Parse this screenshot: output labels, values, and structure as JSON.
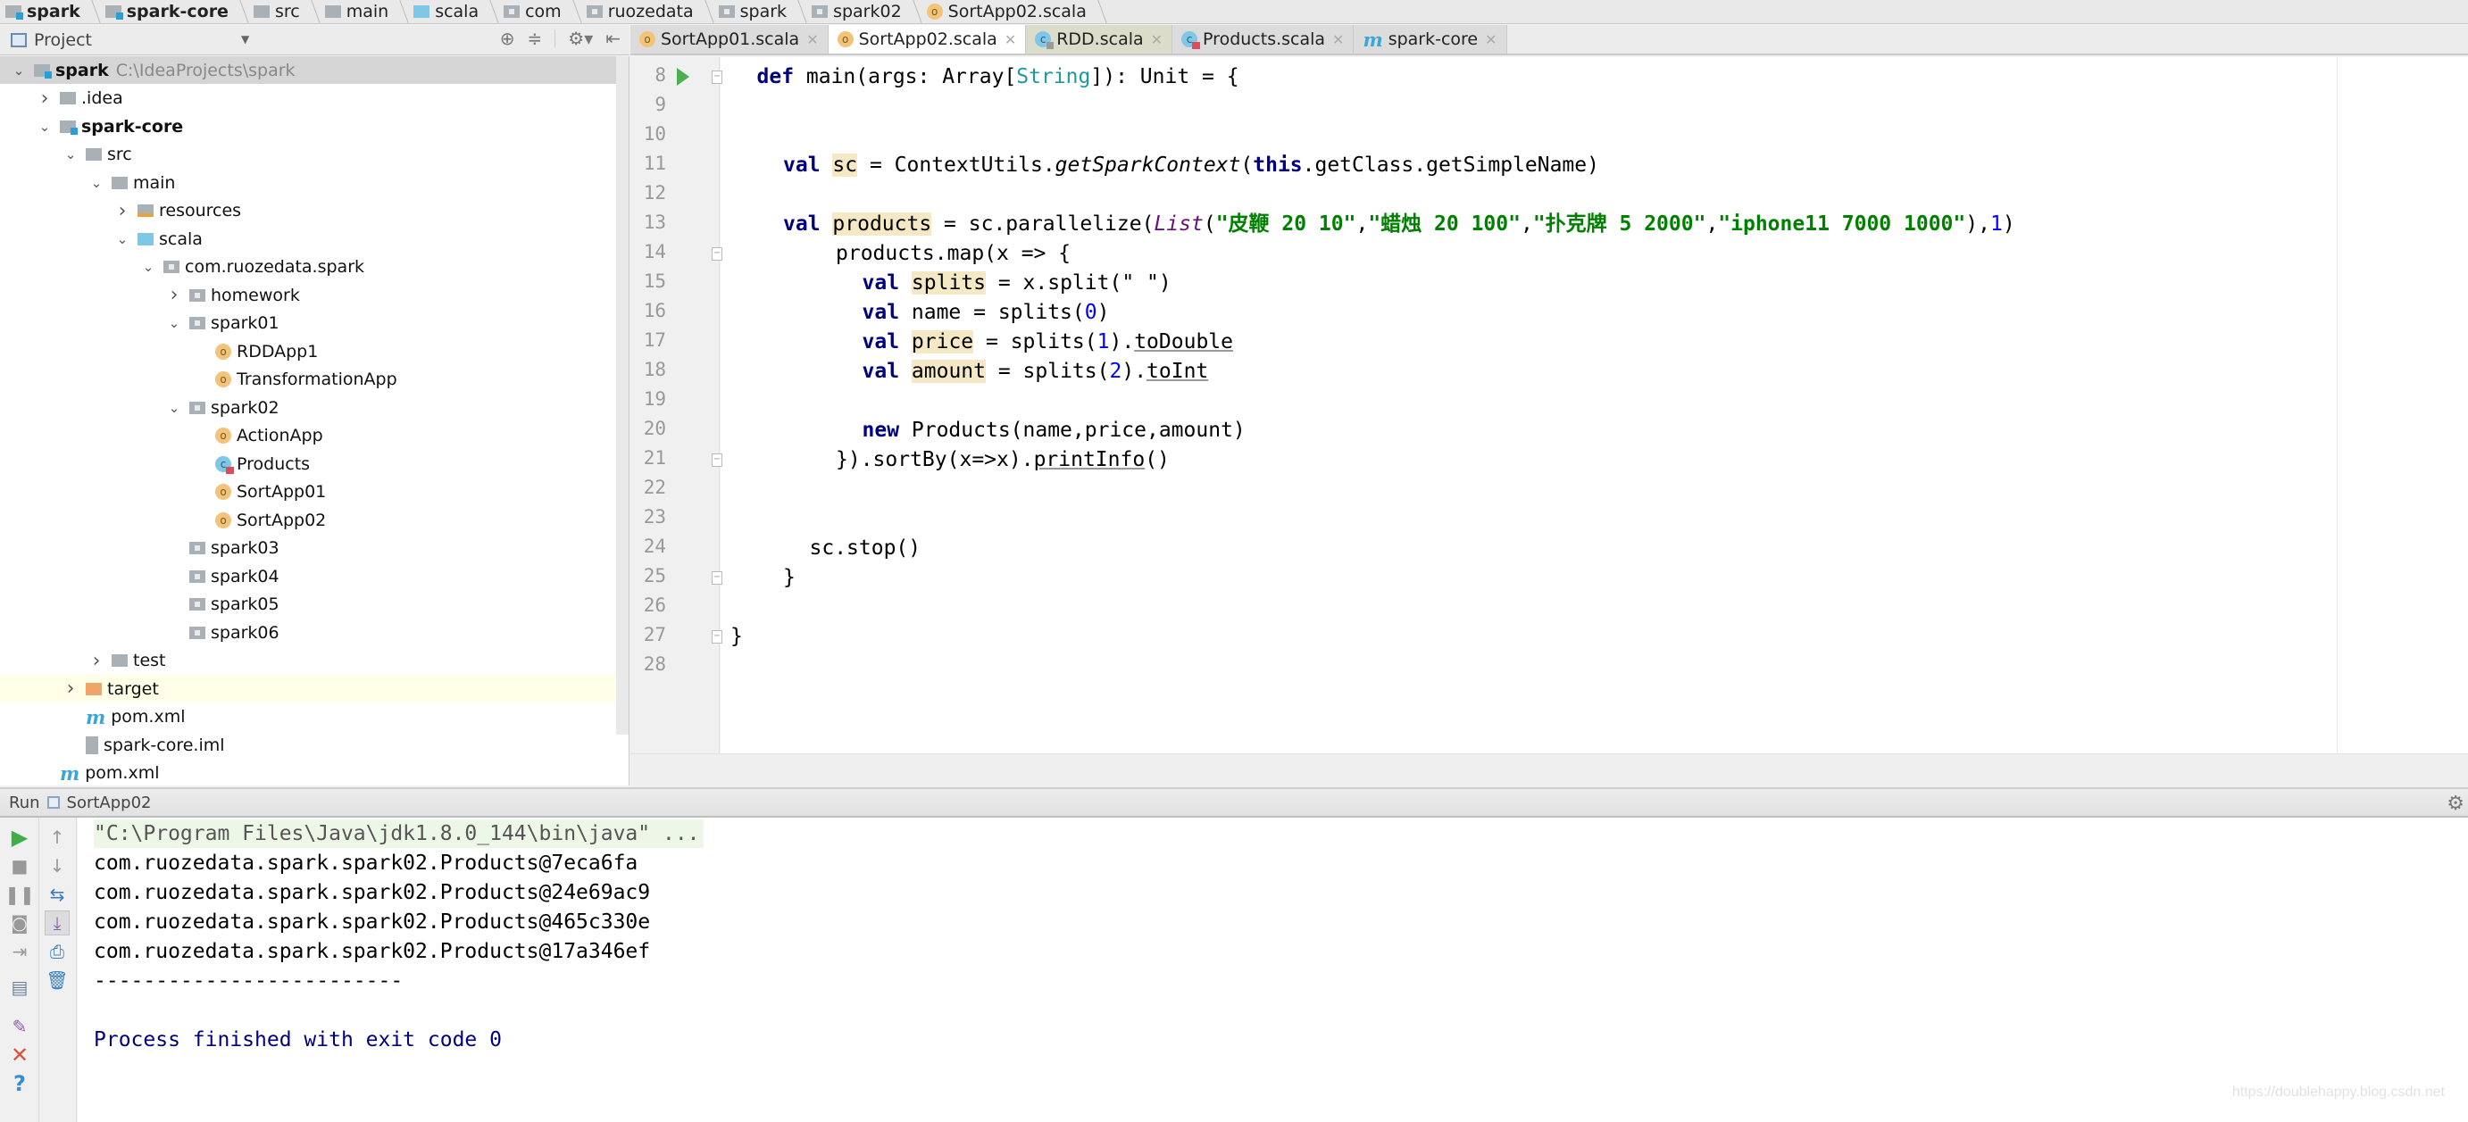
{
  "breadcrumb": [
    {
      "label": "spark",
      "icon": "module-folder-icon",
      "bold": true
    },
    {
      "label": "spark-core",
      "icon": "module-folder-icon",
      "bold": true
    },
    {
      "label": "src",
      "icon": "folder-icon"
    },
    {
      "label": "main",
      "icon": "folder-icon"
    },
    {
      "label": "scala",
      "icon": "source-folder-icon"
    },
    {
      "label": "com",
      "icon": "package-icon"
    },
    {
      "label": "ruozedata",
      "icon": "package-icon"
    },
    {
      "label": "spark",
      "icon": "package-icon"
    },
    {
      "label": "spark02",
      "icon": "package-icon"
    },
    {
      "label": "SortApp02.scala",
      "icon": "scala-object-icon"
    }
  ],
  "project_panel": {
    "title": "Project",
    "tools": [
      "locate-icon",
      "collapse-all-icon",
      "settings-icon",
      "hide-icon"
    ],
    "tree": [
      {
        "label": "spark",
        "path": "C:\\IdeaProjects\\spark",
        "depth": 0,
        "arrow": "down",
        "icon": "module",
        "bold": true,
        "selected": true
      },
      {
        "label": ".idea",
        "depth": 1,
        "arrow": "right",
        "icon": "folder"
      },
      {
        "label": "spark-core",
        "depth": 1,
        "arrow": "down",
        "icon": "module",
        "bold": true
      },
      {
        "label": "src",
        "depth": 2,
        "arrow": "down",
        "icon": "folder"
      },
      {
        "label": "main",
        "depth": 3,
        "arrow": "down",
        "icon": "folder"
      },
      {
        "label": "resources",
        "depth": 4,
        "arrow": "right",
        "icon": "resources"
      },
      {
        "label": "scala",
        "depth": 4,
        "arrow": "down",
        "icon": "source"
      },
      {
        "label": "com.ruozedata.spark",
        "depth": 5,
        "arrow": "down",
        "icon": "package"
      },
      {
        "label": "homework",
        "depth": 6,
        "arrow": "right",
        "icon": "package"
      },
      {
        "label": "spark01",
        "depth": 6,
        "arrow": "down",
        "icon": "package"
      },
      {
        "label": "RDDApp1",
        "depth": 7,
        "arrow": "",
        "icon": "object"
      },
      {
        "label": "TransformationApp",
        "depth": 7,
        "arrow": "",
        "icon": "object"
      },
      {
        "label": "spark02",
        "depth": 6,
        "arrow": "down",
        "icon": "package"
      },
      {
        "label": "ActionApp",
        "depth": 7,
        "arrow": "",
        "icon": "object"
      },
      {
        "label": "Products",
        "depth": 7,
        "arrow": "",
        "icon": "class"
      },
      {
        "label": "SortApp01",
        "depth": 7,
        "arrow": "",
        "icon": "object"
      },
      {
        "label": "SortApp02",
        "depth": 7,
        "arrow": "",
        "icon": "object"
      },
      {
        "label": "spark03",
        "depth": 6,
        "arrow": "",
        "icon": "package"
      },
      {
        "label": "spark04",
        "depth": 6,
        "arrow": "",
        "icon": "package"
      },
      {
        "label": "spark05",
        "depth": 6,
        "arrow": "",
        "icon": "package"
      },
      {
        "label": "spark06",
        "depth": 6,
        "arrow": "",
        "icon": "package"
      },
      {
        "label": "test",
        "depth": 3,
        "arrow": "right",
        "icon": "folder"
      },
      {
        "label": "target",
        "depth": 2,
        "arrow": "right",
        "icon": "excluded",
        "highlight": true
      },
      {
        "label": "pom.xml",
        "depth": 2,
        "arrow": "",
        "icon": "maven"
      },
      {
        "label": "spark-core.iml",
        "depth": 2,
        "arrow": "",
        "icon": "iml"
      },
      {
        "label": "pom.xml",
        "depth": 1,
        "arrow": "",
        "icon": "maven"
      }
    ]
  },
  "tabs": [
    {
      "label": "SortApp01.scala",
      "icon": "object",
      "active": false
    },
    {
      "label": "SortApp02.scala",
      "icon": "object",
      "active": true
    },
    {
      "label": "RDD.scala",
      "icon": "class-lock",
      "active": false,
      "lib": true
    },
    {
      "label": "Products.scala",
      "icon": "class",
      "active": false
    },
    {
      "label": "spark-core",
      "icon": "maven",
      "active": false
    }
  ],
  "editor": {
    "lines": [
      {
        "n": "8",
        "run": true,
        "fold": "open",
        "indent": 1,
        "tokens": [
          [
            "kw",
            "def"
          ],
          [
            "",
            " main(args: Array["
          ],
          [
            "tp",
            "String"
          ],
          [
            "",
            "]): Unit = {"
          ]
        ]
      },
      {
        "n": "9",
        "indent": 0,
        "tokens": []
      },
      {
        "n": "10",
        "indent": 0,
        "tokens": []
      },
      {
        "n": "11",
        "indent": 2,
        "tokens": [
          [
            "kw",
            "val"
          ],
          [
            "",
            " "
          ],
          [
            "ref",
            "sc"
          ],
          [
            "",
            " = ContextUtils."
          ],
          [
            "it",
            "getSparkContext"
          ],
          [
            "",
            "("
          ],
          [
            "kw",
            "this"
          ],
          [
            "",
            ".getClass.getSimpleName)"
          ]
        ]
      },
      {
        "n": "12",
        "indent": 0,
        "tokens": []
      },
      {
        "n": "13",
        "indent": 2,
        "tokens": [
          [
            "kw",
            "val"
          ],
          [
            "",
            " "
          ],
          [
            "ref",
            "products"
          ],
          [
            "",
            " = sc.parallelize("
          ],
          [
            "lst",
            "List"
          ],
          [
            "",
            "("
          ],
          [
            "str",
            "\"皮鞭 20 10\""
          ],
          [
            "",
            ","
          ],
          [
            "str",
            "\"蜡烛 20 100\""
          ],
          [
            "",
            ","
          ],
          [
            "str",
            "\"扑克牌 5 2000\""
          ],
          [
            "",
            ","
          ],
          [
            "str",
            "\"iphone11 7000 1000\""
          ],
          [
            "",
            "),"
          ],
          [
            "num",
            "1"
          ],
          [
            "",
            ")"
          ]
        ]
      },
      {
        "n": "14",
        "fold": "open",
        "indent": 4,
        "tokens": [
          [
            "",
            "products.map(x => {"
          ]
        ]
      },
      {
        "n": "15",
        "indent": 5,
        "tokens": [
          [
            "kw",
            "val"
          ],
          [
            "",
            " "
          ],
          [
            "ref",
            "splits"
          ],
          [
            "",
            " = x.split("
          ],
          [
            "str2",
            "\" \""
          ],
          [
            "",
            ")"
          ]
        ]
      },
      {
        "n": "16",
        "indent": 5,
        "tokens": [
          [
            "kw",
            "val"
          ],
          [
            "",
            " name = splits("
          ],
          [
            "num",
            "0"
          ],
          [
            "",
            ")"
          ]
        ]
      },
      {
        "n": "17",
        "indent": 5,
        "tokens": [
          [
            "kw",
            "val"
          ],
          [
            "",
            " "
          ],
          [
            "ref",
            "price"
          ],
          [
            "",
            " = splits("
          ],
          [
            "num",
            "1"
          ],
          [
            "",
            ")."
          ],
          [
            "und",
            "toDouble"
          ]
        ]
      },
      {
        "n": "18",
        "indent": 5,
        "tokens": [
          [
            "kw",
            "val"
          ],
          [
            "",
            " "
          ],
          [
            "ref",
            "amount"
          ],
          [
            "",
            " = splits("
          ],
          [
            "num",
            "2"
          ],
          [
            "",
            ")."
          ],
          [
            "und",
            "toInt"
          ]
        ]
      },
      {
        "n": "19",
        "indent": 0,
        "tokens": []
      },
      {
        "n": "20",
        "indent": 5,
        "tokens": [
          [
            "kw",
            "new"
          ],
          [
            "",
            " Products(name,price,amount)"
          ]
        ]
      },
      {
        "n": "21",
        "fold": "close",
        "indent": 4,
        "tokens": [
          [
            "",
            "}).sortBy(x=>x)."
          ],
          [
            "und",
            "printInfo"
          ],
          [
            "",
            "()"
          ]
        ]
      },
      {
        "n": "22",
        "indent": 0,
        "tokens": []
      },
      {
        "n": "23",
        "indent": 0,
        "tokens": []
      },
      {
        "n": "24",
        "indent": 3,
        "tokens": [
          [
            "",
            "sc.stop()"
          ]
        ]
      },
      {
        "n": "25",
        "fold": "close",
        "indent": 2,
        "tokens": [
          [
            "",
            "}"
          ]
        ]
      },
      {
        "n": "26",
        "indent": 0,
        "tokens": []
      },
      {
        "n": "27",
        "fold": "close",
        "indent": 0,
        "tokens": [
          [
            "",
            "}"
          ]
        ]
      },
      {
        "n": "28",
        "indent": 0,
        "tokens": []
      }
    ]
  },
  "run_panel": {
    "label": "Run",
    "config": "SortApp02",
    "console": [
      {
        "type": "cmd",
        "text": "\"C:\\Program Files\\Java\\jdk1.8.0_144\\bin\\java\" ..."
      },
      {
        "type": "out",
        "text": "com.ruozedata.spark.spark02.Products@7eca6fa"
      },
      {
        "type": "out",
        "text": "com.ruozedata.spark.spark02.Products@24e69ac9"
      },
      {
        "type": "out",
        "text": "com.ruozedata.spark.spark02.Products@465c330e"
      },
      {
        "type": "out",
        "text": "com.ruozedata.spark.spark02.Products@17a346ef"
      },
      {
        "type": "out",
        "text": "-------------------------"
      },
      {
        "type": "blank",
        "text": ""
      },
      {
        "type": "exit",
        "text": "Process finished with exit code 0"
      }
    ],
    "tools_left": [
      "rerun-icon",
      "stop-icon",
      "pause-icon",
      "dump-threads-icon",
      "exit-icon",
      "layout-icon",
      "pin-icon",
      "close-icon",
      "help-icon"
    ],
    "tools_right": [
      "scroll-up-icon",
      "scroll-down-icon",
      "soft-wrap-icon",
      "scroll-to-end-icon",
      "print-icon",
      "clear-icon"
    ]
  },
  "watermark": "https://doublehappy.blog.csdn.net",
  "colors": {
    "keyword": "#000080",
    "string": "#008000",
    "number": "#0000ff",
    "type_param": "#20999d",
    "ref_highlight": "#f4e9c4",
    "run_green": "#4caf50",
    "target_folder": "#f0a46a"
  }
}
